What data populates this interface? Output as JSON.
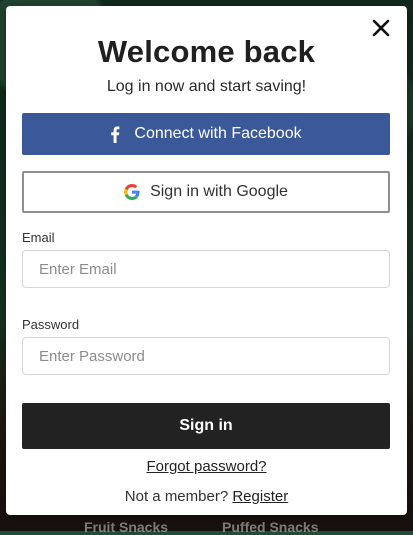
{
  "background": {
    "items": [
      "Fruit Snacks",
      "Puffed Snacks"
    ]
  },
  "modal": {
    "title": "Welcome back",
    "subtitle": "Log in now and start saving!",
    "close_icon": "close-icon"
  },
  "social": {
    "facebook_label": "Connect with Facebook",
    "google_label": "Sign in with Google",
    "facebook_color": "#3b5998"
  },
  "form": {
    "email_label": "Email",
    "email_placeholder": "Enter Email",
    "email_value": "",
    "password_label": "Password",
    "password_placeholder": "Enter Password",
    "password_value": "",
    "submit_label": "Sign in",
    "submit_color": "#222222"
  },
  "footer": {
    "forgot_label": "Forgot password?",
    "member_prompt": "Not a member?",
    "register_label": "Register"
  }
}
